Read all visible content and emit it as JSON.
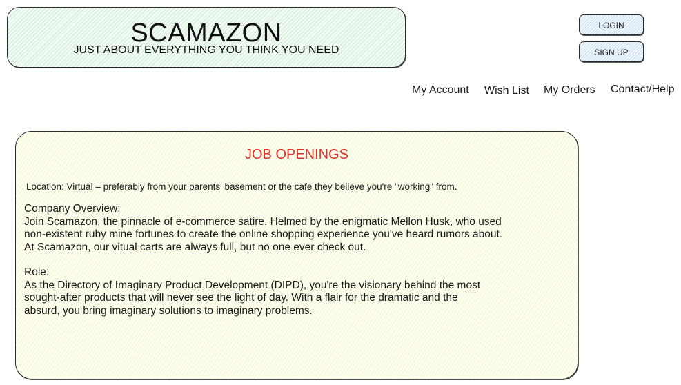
{
  "header": {
    "title": "SCAMAZON",
    "tagline": "JUST ABOUT EVERYTHING YOU THINK YOU NEED"
  },
  "auth": {
    "login_label": "LOGIN",
    "signup_label": "SIGN UP"
  },
  "nav": {
    "account": "My Account",
    "wishlist": "Wish List",
    "orders": "My Orders",
    "contact": "Contact/Help"
  },
  "jobs": {
    "title": "JOB OPENINGS",
    "location": "Location: Virtual – preferably from your parents' basement or the cafe they believe you're \"working\" from.",
    "overview": {
      "heading": "Company Overview:",
      "lines": [
        "Join Scamazon, the pinnacle of e-commerce satire. Helmed by the enigmatic Mellon Husk, who used",
        "non-existent ruby mine fortunes to create the online shopping experience you've heard rumors about.",
        "At Scamazon, our vitual carts are always full, but no one ever check out."
      ]
    },
    "role": {
      "heading": "Role:",
      "lines": [
        "As the Directory of Imaginary Product Development (DIPD), you're the visionary behind the most",
        "sought-after products that will never see the light of day. With a flair for the dramatic and the",
        "absurd, you bring imaginary solutions to imaginary problems."
      ]
    }
  },
  "colors": {
    "header_fill": "#d9f2df",
    "button_fill": "#dcebf7",
    "jobs_fill": "#fbfbdc",
    "jobs_title": "#e0302a"
  }
}
